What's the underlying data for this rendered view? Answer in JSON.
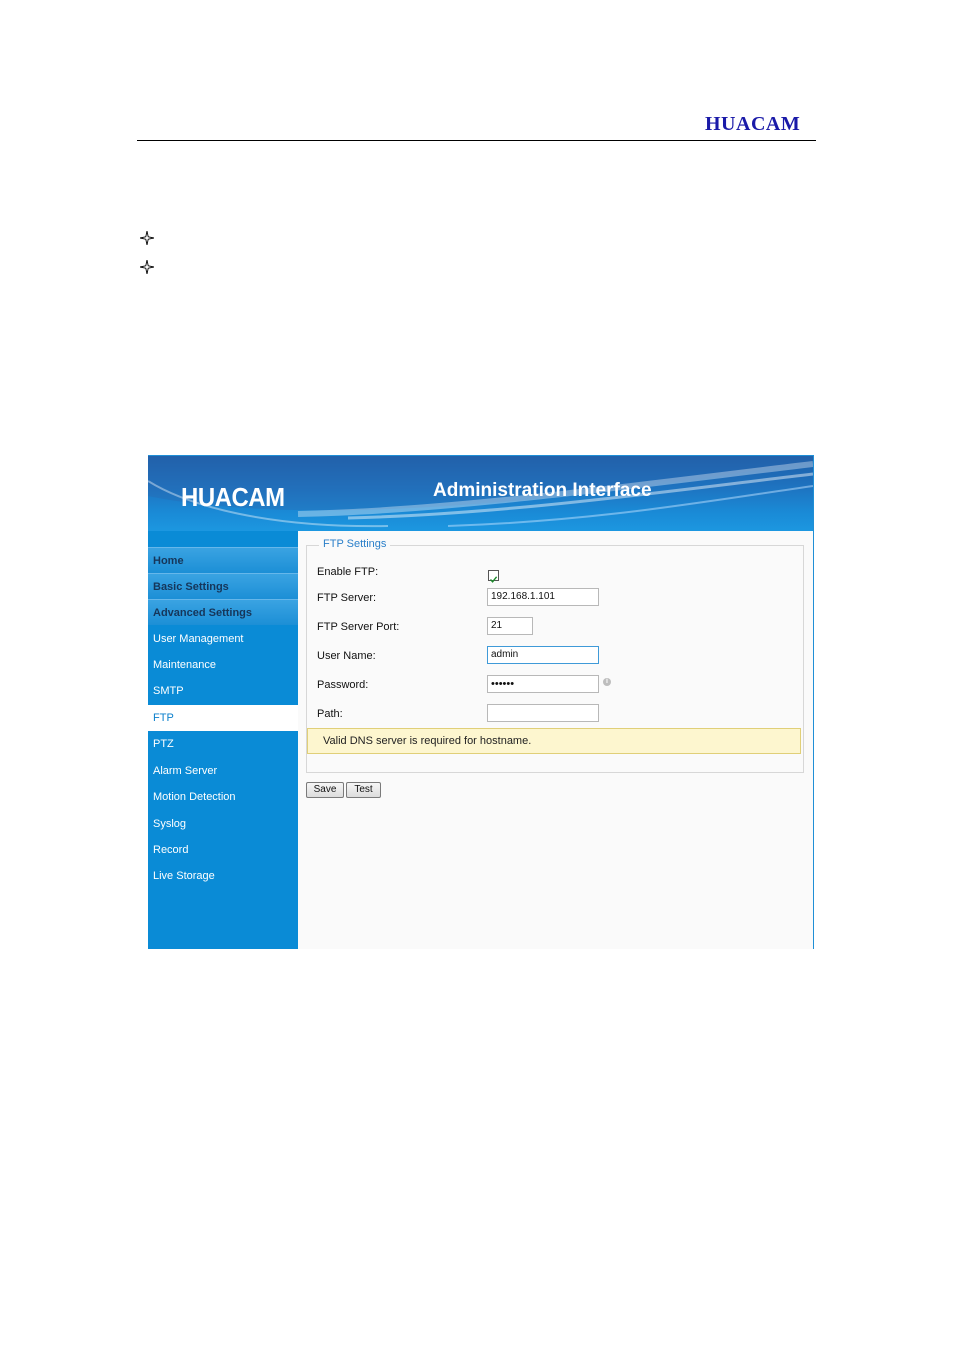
{
  "doc": {
    "logo": "HUACAM"
  },
  "bullets": [
    {
      "icon": "four-point-star-icon"
    },
    {
      "icon": "four-point-star-icon"
    }
  ],
  "screenshot": {
    "brand": "HUACAM",
    "title": "Administration Interface",
    "nav": [
      {
        "label": "Home",
        "type": "section"
      },
      {
        "label": "Basic Settings",
        "type": "section"
      },
      {
        "label": "Advanced Settings",
        "type": "section"
      },
      {
        "label": "User Management",
        "type": "item"
      },
      {
        "label": "Maintenance",
        "type": "item"
      },
      {
        "label": "SMTP",
        "type": "item"
      },
      {
        "label": "FTP",
        "type": "active"
      },
      {
        "label": "PTZ",
        "type": "item"
      },
      {
        "label": "Alarm Server",
        "type": "item"
      },
      {
        "label": "Motion Detection",
        "type": "item"
      },
      {
        "label": "Syslog",
        "type": "item"
      },
      {
        "label": "Record",
        "type": "item"
      },
      {
        "label": "Live Storage",
        "type": "item"
      }
    ],
    "form": {
      "legend": "FTP Settings",
      "enable_label": "Enable FTP:",
      "enable_checked": true,
      "server_label": "FTP Server:",
      "server_value": "192.168.1.101",
      "port_label": "FTP Server Port:",
      "port_value": "21",
      "user_label": "User Name:",
      "user_value": "admin",
      "password_label": "Password:",
      "password_value": "••••••",
      "path_label": "Path:",
      "path_value": "",
      "notice": "Valid DNS server is required for hostname.",
      "save_label": "Save",
      "test_label": "Test"
    },
    "colors": {
      "sidebar": "#0a8bd6",
      "legend": "#2a7fc9",
      "notice_bg": "#fdf6cf"
    }
  }
}
